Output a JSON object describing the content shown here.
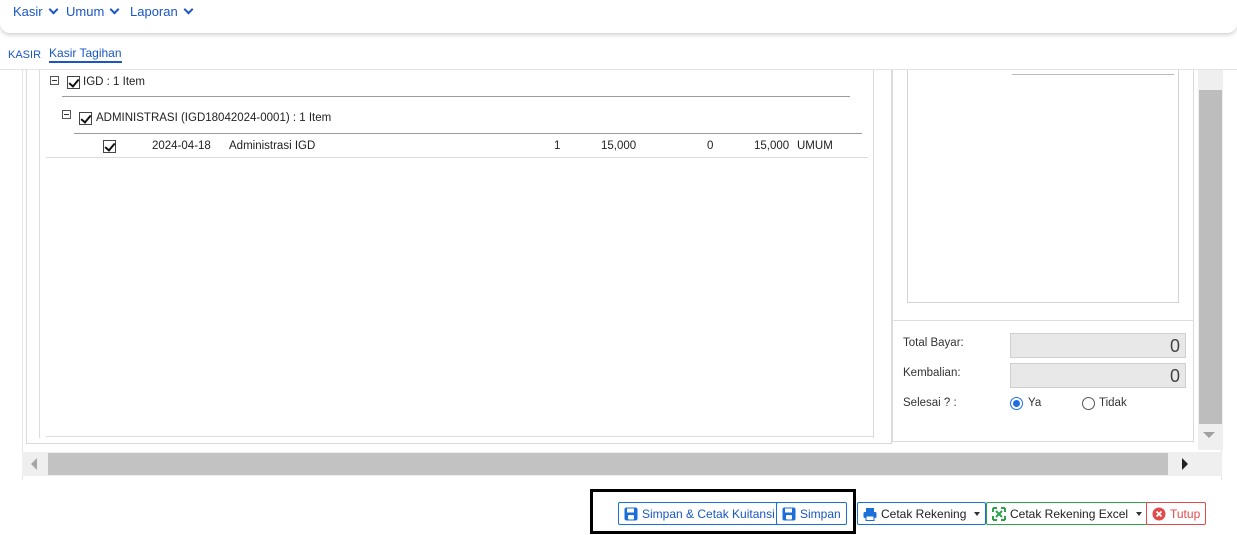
{
  "nav": {
    "items": [
      "Kasir",
      "Umum",
      "Laporan"
    ]
  },
  "breadcrumb": {
    "root": "KASIR",
    "current": "Kasir Tagihan"
  },
  "grid": {
    "group1_label": "IGD : 1 Item",
    "group2_label": "ADMINISTRASI (IGD18042024-0001) : 1 Item",
    "row": {
      "date": "2024-04-18",
      "item": "Administrasi IGD",
      "qty": "1",
      "price": "15,000",
      "discount": "0",
      "total": "15,000",
      "payer": "UMUM"
    }
  },
  "summary": {
    "total_bayar_label": "Total Bayar:",
    "total_bayar_value": "0",
    "kembalian_label": "Kembalian:",
    "kembalian_value": "0",
    "selesai_label": "Selesai ? :",
    "option_ya": "Ya",
    "option_tidak": "Tidak",
    "selected": "Ya"
  },
  "buttons": {
    "simpan_cetak": "Simpan & Cetak Kuitansi",
    "simpan": "Simpan",
    "cetak_rekening": "Cetak Rekening",
    "cetak_rekening_excel": "Cetak Rekening Excel",
    "tutup": "Tutup"
  },
  "colors": {
    "accent": "#1a56c4",
    "excel_green": "#2fa34b",
    "close_red": "#e04a4a"
  }
}
